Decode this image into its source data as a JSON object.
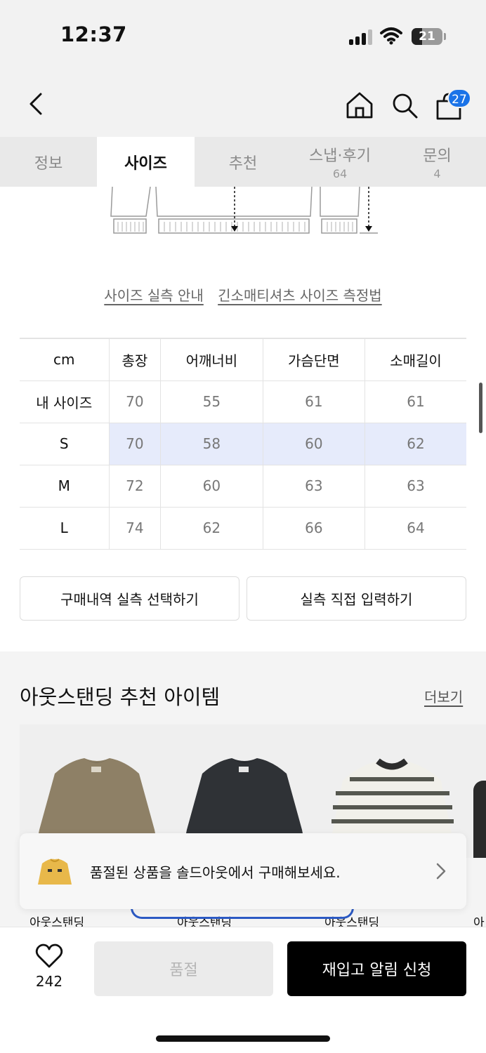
{
  "status_bar": {
    "time": "12:37",
    "battery": "21"
  },
  "header": {
    "cart_count": "27"
  },
  "tabs": [
    {
      "label": "정보",
      "count": ""
    },
    {
      "label": "사이즈",
      "count": ""
    },
    {
      "label": "추천",
      "count": ""
    },
    {
      "label": "스냅·후기",
      "count": "64"
    },
    {
      "label": "문의",
      "count": "4"
    }
  ],
  "size_links": {
    "actual_size_guide": "사이즈 실측 안내",
    "measure_method": "긴소매티셔츠 사이즈 측정법"
  },
  "size_table": {
    "headers": [
      "cm",
      "총장",
      "어깨너비",
      "가슴단면",
      "소매길이"
    ],
    "rows": [
      {
        "label": "내 사이즈",
        "values": [
          "70",
          "55",
          "61",
          "61"
        ]
      },
      {
        "label": "S",
        "values": [
          "70",
          "58",
          "60",
          "62"
        ]
      },
      {
        "label": "M",
        "values": [
          "72",
          "60",
          "63",
          "63"
        ]
      },
      {
        "label": "L",
        "values": [
          "74",
          "62",
          "66",
          "64"
        ]
      }
    ]
  },
  "actions": {
    "select_purchase": "구매내역 실측 선택하기",
    "direct_input": "실측 직접 입력하기"
  },
  "recommendation": {
    "title": "아웃스탠딩 추천 아이템",
    "more": "더보기",
    "brands": [
      "아웃스탠딩",
      "아웃스탠딩",
      "아웃스탠딩",
      "아"
    ]
  },
  "toast": {
    "text": "품절된 상품을 솔드아웃에서 구매해보세요."
  },
  "bottom_bar": {
    "like_count": "242",
    "soldout_label": "품절",
    "restock_label": "재입고 알림 신청"
  },
  "colors": {
    "accent": "#1a73e8",
    "highlight_row": "#e6ebfb",
    "primary_button": "#000000"
  }
}
